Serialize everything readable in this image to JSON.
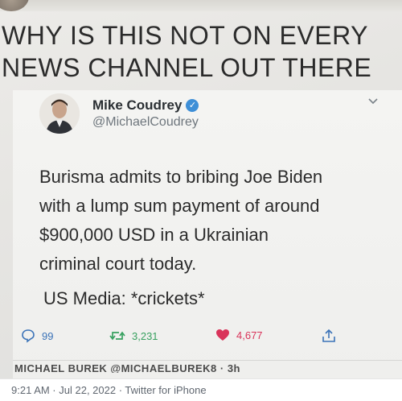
{
  "headline": "WHY IS THIS NOT ON EVERY\nNEWS CHANNEL OUT THERE",
  "tweet": {
    "author_name": "Mike Coudrey",
    "author_handle": "@MichaelCoudrey",
    "text": "Burisma admits to bribing Joe Biden\nwith a lump sum payment of around\n$900,000 USD in a Ukrainian\ncriminal court today.",
    "reply_text": "US Media: *crickets*",
    "stats": {
      "replies": "99",
      "retweets": "3,231",
      "likes": "4,677"
    },
    "next_tweet_cutoff": "MICHAEL BUREK @MICHAELBUREK8 · 3h"
  },
  "icons": {
    "verified": "verified-badge-icon",
    "chevron": "chevron-down-icon",
    "reply": "reply-bubble-icon",
    "retweet": "retweet-icon",
    "like": "heart-icon",
    "share": "share-icon"
  },
  "colors": {
    "verified": "#3e8fd7",
    "retweet": "#37a05f",
    "like": "#d9345a",
    "reply": "#3b73b8",
    "share": "#3b73b8"
  },
  "footer": {
    "meta": "9:21 AM · Jul 22, 2022 · Twitter for iPhone"
  }
}
